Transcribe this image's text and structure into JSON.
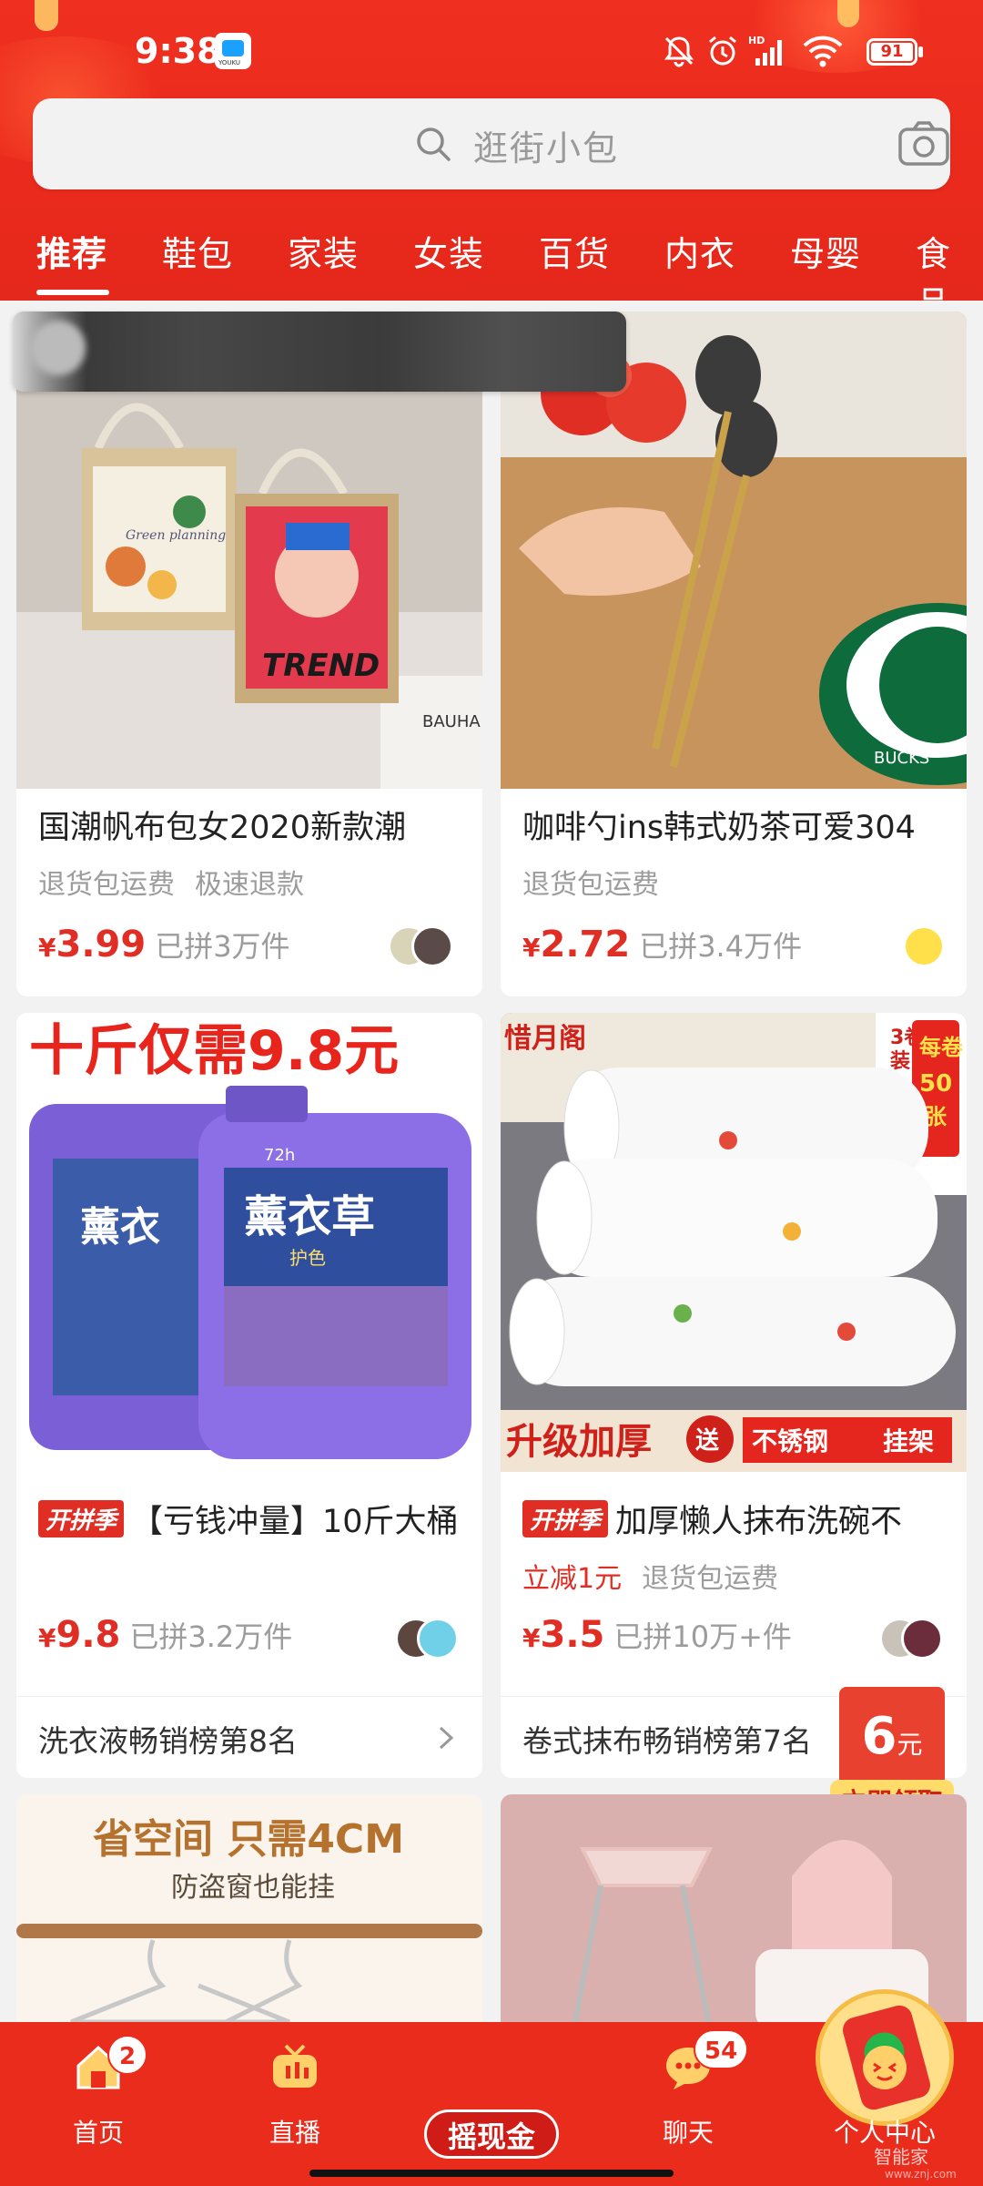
{
  "statusbar": {
    "time": "9:38",
    "app_badge": "YOUKU",
    "battery": "91"
  },
  "search": {
    "placeholder": "逛街小包"
  },
  "tabs": [
    "推荐",
    "鞋包",
    "家装",
    "女装",
    "百货",
    "内衣",
    "母婴",
    "食品"
  ],
  "products": [
    {
      "title": "国潮帆布包女2020新款潮",
      "tags": [
        "退货包运费",
        "极速退款"
      ],
      "currency": "¥",
      "price": "3.99",
      "sold": "已拼3万件",
      "image_text": [
        "Green planning",
        "TREND",
        "BAUHA"
      ]
    },
    {
      "title": "咖啡勺ins韩式奶茶可爱304",
      "tags": [
        "退货包运费"
      ],
      "currency": "¥",
      "price": "2.72",
      "sold": "已拼3.4万件",
      "image_text": [
        "BUCKS"
      ]
    },
    {
      "badge": "开拼季",
      "title": "【亏钱冲量】10斤大桶",
      "tags": [],
      "currency": "¥",
      "price": "9.8",
      "sold": "已拼3.2万件",
      "rank": "洗衣液畅销榜第8名",
      "image_text": [
        "十斤仅需9.8元",
        "薰衣草",
        "护色",
        "72h"
      ]
    },
    {
      "badge": "开拼季",
      "title": "加厚懒人抹布洗碗不",
      "tags_red": [
        "立减1元"
      ],
      "tags": [
        "退货包运费"
      ],
      "currency": "¥",
      "price": "3.5",
      "sold": "已拼10万+件",
      "rank": "卷式抹布畅销榜第7名",
      "image_text": [
        "惜月阁",
        "3卷装",
        "每卷50张",
        "升级加厚",
        "送",
        "不锈钢",
        "挂架"
      ]
    },
    {
      "image_text": [
        "省空间 只需4CM",
        "防盗窗也能挂"
      ]
    },
    {
      "image_text": []
    }
  ],
  "coupon": {
    "value": "6",
    "unit": "元",
    "button": "立即领取"
  },
  "bottom_nav": {
    "home": {
      "label": "首页",
      "badge": "2"
    },
    "live": {
      "label": "直播"
    },
    "shake": {
      "label": "摇现金"
    },
    "chat": {
      "label": "聊天",
      "badge": "54"
    },
    "profile": {
      "label": "个人中心"
    }
  },
  "watermark": {
    "text": "智能家",
    "url": "www.znj.com"
  },
  "colors": {
    "brand_red": "#e02e24",
    "header_red": "#ea2a1c",
    "bg": "#f2f2f2"
  }
}
